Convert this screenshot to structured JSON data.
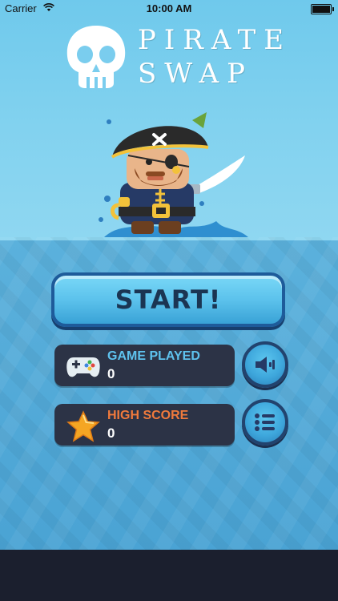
{
  "status_bar": {
    "carrier": "Carrier",
    "time": "10:00 AM"
  },
  "title": {
    "line1": "PIRATE",
    "line2": "SWAP"
  },
  "start_button": {
    "label": "START!"
  },
  "stats": {
    "games_played": {
      "label": "GAME PLAYED",
      "value": "0",
      "label_color": "#5ec2ee",
      "icon": "gamepad-icon"
    },
    "high_score": {
      "label": "HIGH SCORE",
      "value": "0",
      "label_color": "#f07a3c",
      "icon": "star-icon"
    }
  },
  "side_buttons": [
    {
      "icon": "speaker-icon"
    },
    {
      "icon": "menu-list-icon"
    }
  ],
  "colors": {
    "panel": "#2c3346",
    "sky": "#82d2ef",
    "sea": "#4aa3d4",
    "button_border": "#1e5b9a"
  }
}
